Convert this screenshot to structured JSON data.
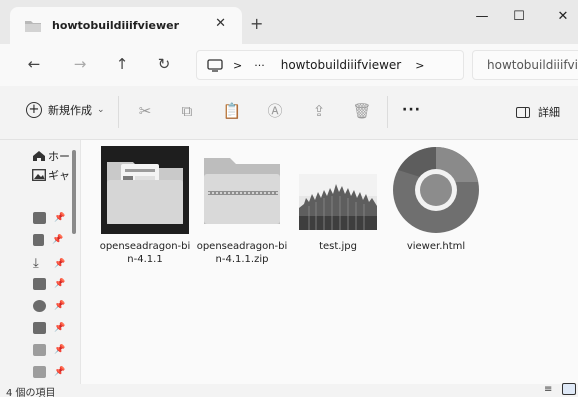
{
  "window": {
    "tab_title": "howtobuildiiifviewer",
    "tab_close": "✕",
    "new_tab": "+",
    "minimize": "—",
    "maximize": "☐",
    "close": "✕"
  },
  "nav": {
    "back": "←",
    "forward": "→",
    "up": "↑",
    "refresh": "↻"
  },
  "address": {
    "separator": ">",
    "overflow": "···",
    "folder": "howtobuildiiifviewer",
    "trailing_separator": ">"
  },
  "search": {
    "text": "howtobuildiiifviewer"
  },
  "toolbar": {
    "new_label": "新規作成",
    "new_caret": "⌄",
    "more": "···",
    "details_label": "詳細"
  },
  "sidebar": {
    "items": [
      {
        "label": "ホー",
        "icon": "home-icon"
      },
      {
        "label": "ギャ",
        "icon": "gallery-icon"
      }
    ],
    "pinned": [
      {
        "icon": "desktop-icon"
      },
      {
        "icon": "documents-icon"
      },
      {
        "icon": "downloads-icon"
      },
      {
        "icon": "pictures-icon"
      },
      {
        "icon": "music-icon"
      },
      {
        "icon": "videos-icon"
      },
      {
        "icon": "folder-icon"
      },
      {
        "icon": "folder-icon"
      }
    ],
    "pin_glyph": "📌"
  },
  "files": [
    {
      "name": "openseadragon-bin-4.1.1",
      "type": "folder",
      "selected": true
    },
    {
      "name": "openseadragon-bin-4.1.1.zip",
      "type": "zip"
    },
    {
      "name": "test.jpg",
      "type": "image"
    },
    {
      "name": "viewer.html",
      "type": "chrome"
    }
  ],
  "status": {
    "item_count": "4 個の項目"
  },
  "colors": {
    "titlebar": "#e9e9e9",
    "folder": "#d8d8d8",
    "selected_bg": "#1e1e1e",
    "chrome_outer": "#6f6f6f",
    "chrome_inner": "#e6e6e6"
  }
}
